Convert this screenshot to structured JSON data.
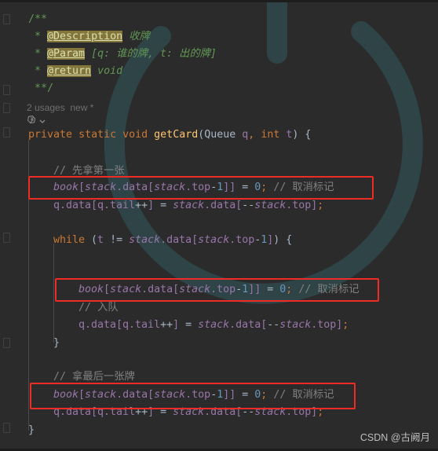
{
  "editor": {
    "theme_bg": "#2b2b2b",
    "accent_red": "#ee2b24",
    "watermark_icon": "power-button-watermark",
    "watermark_color": "#2e4447"
  },
  "gutter": {
    "code_vision_icon": "code-vision-icon",
    "chevron": "⌄"
  },
  "code_vision": {
    "usages": "2 usages",
    "new": "new *"
  },
  "javadoc": {
    "open": "/**",
    "line1_star": "*",
    "line1_tag": "@Description",
    "line1_text": "收牌",
    "line2_star": "*",
    "line2_tag": "@Param",
    "line2_text": "[q: 谁的牌, t: 出的牌]",
    "line3_star": "*",
    "line3_tag": "@return",
    "line3_text": "void",
    "close": "**/"
  },
  "signature": {
    "modifier1": "private",
    "modifier2": "static",
    "return_type": "void",
    "name": "getCard",
    "paren_open": "(",
    "param1_type": "Queue",
    "param1_name": "q",
    "comma": ", ",
    "param2_type": "int",
    "param2_name": "t",
    "paren_close": ")",
    "brace": " {"
  },
  "lines": {
    "comment_first": "// 先拿第一张",
    "stmt_book": "book[stack.data[stack.top-1]] = 0;",
    "stmt_book_comment": "// 取消标记",
    "stmt_enqueue": "q.data[q.tail++] = stack.data[--stack.top];",
    "while_head": "while (t != stack.data[stack.top-1]) {",
    "comment_enqueue": "// 入队",
    "comment_last": "// 拿最后一张牌",
    "close_brace_inner": "}",
    "close_brace_outer": "}"
  },
  "highlights": [
    {
      "name": "redbox-first-card",
      "label": "book[stack.data[stack.top-1]] = 0; // 取消标记"
    },
    {
      "name": "redbox-while-body",
      "label": "book[stack.data[stack.top-1]] = 0; // 取消标记"
    },
    {
      "name": "redbox-last-card",
      "label": "book[stack.data[stack.top-1]] = 0; // 取消标记"
    }
  ],
  "watermark": {
    "text": "CSDN @古阙月"
  }
}
